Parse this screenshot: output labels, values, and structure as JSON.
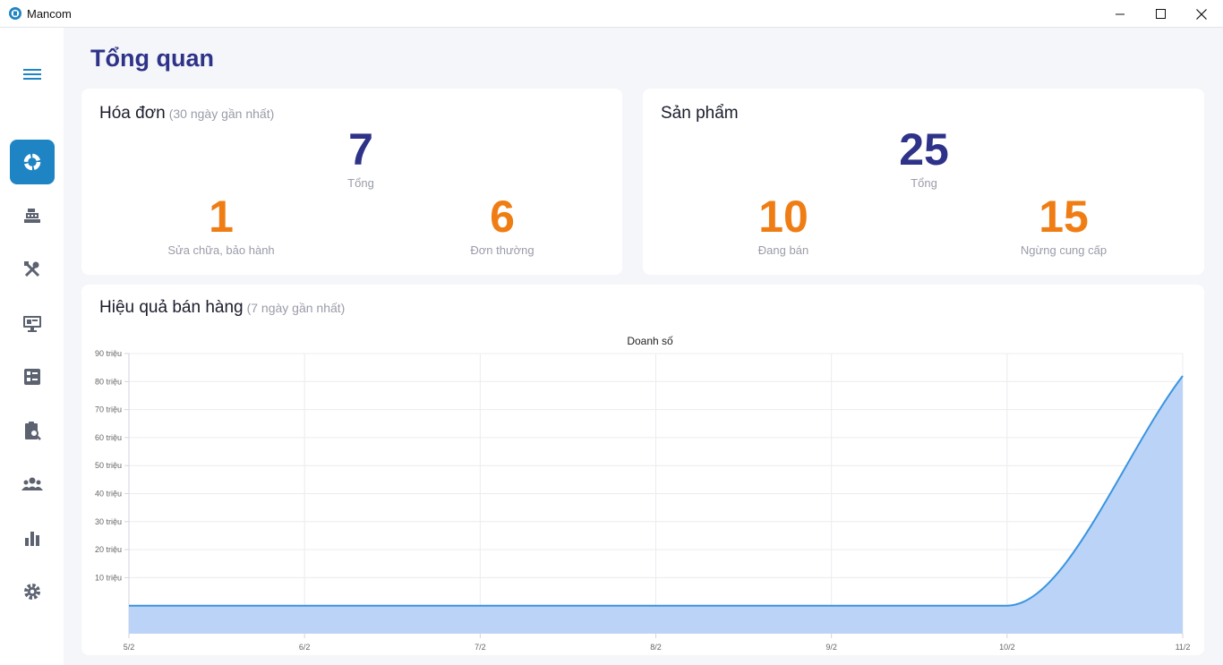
{
  "window": {
    "title": "Mancom"
  },
  "page": {
    "title": "Tổng quan"
  },
  "invoices": {
    "title": "Hóa đơn",
    "subtitle": "(30 ngày gần nhất)",
    "total": "7",
    "total_label": "Tổng",
    "repair": "1",
    "repair_label": "Sửa chữa, bảo hành",
    "regular": "6",
    "regular_label": "Đơn thường"
  },
  "products": {
    "title": "Sản phẩm",
    "total": "25",
    "total_label": "Tổng",
    "selling": "10",
    "selling_label": "Đang bán",
    "discontinued": "15",
    "discontinued_label": "Ngừng cung cấp"
  },
  "sales": {
    "title": "Hiệu quả bán hàng",
    "subtitle": "(7 ngày gần nhất)"
  },
  "sidebar": {
    "items": [
      {
        "icon": "dashboard-icon",
        "active": true
      },
      {
        "icon": "cash-register-icon",
        "active": false
      },
      {
        "icon": "tools-icon",
        "active": false
      },
      {
        "icon": "monitor-icon",
        "active": false
      },
      {
        "icon": "list-box-icon",
        "active": false
      },
      {
        "icon": "clipboard-search-icon",
        "active": false
      },
      {
        "icon": "users-icon",
        "active": false
      },
      {
        "icon": "bar-chart-icon",
        "active": false
      },
      {
        "icon": "gear-icon",
        "active": false
      }
    ]
  },
  "colors": {
    "accent": "#1f84c4",
    "title": "#2e3288",
    "orange": "#ef7d14",
    "line": "#3a94e0",
    "fill": "#bad3f6"
  },
  "chart_data": {
    "type": "area",
    "title": "Doanh số",
    "x": [
      "5/2",
      "6/2",
      "7/2",
      "8/2",
      "9/2",
      "10/2",
      "11/2"
    ],
    "values": [
      0,
      0,
      0,
      0,
      0,
      0,
      82000000
    ],
    "y_ticks": [
      "10 triệu",
      "20 triệu",
      "30 triệu",
      "40 triệu",
      "50 triệu",
      "60 triệu",
      "70 triệu",
      "80 triệu",
      "90 triệu"
    ],
    "ylim": [
      -10000000,
      90000000
    ],
    "grid": true
  }
}
